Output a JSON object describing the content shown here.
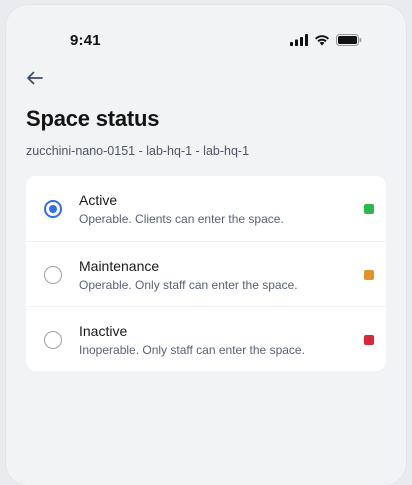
{
  "status_bar": {
    "time": "9:41"
  },
  "page": {
    "title": "Space status",
    "subtitle": "zucchini-nano-0151 - lab-hq-1 - lab-hq-1"
  },
  "options": [
    {
      "label": "Active",
      "description": "Operable. Clients can enter the space.",
      "selected": true,
      "color": "#2fb84a"
    },
    {
      "label": "Maintenance",
      "description": "Operable. Only staff can enter the space.",
      "selected": false,
      "color": "#e3922c"
    },
    {
      "label": "Inactive",
      "description": "Inoperable. Only staff can enter the space.",
      "selected": false,
      "color": "#d8263a"
    }
  ],
  "colors": {
    "accent": "#2f6fec",
    "background": "#f2f3f5",
    "card": "#ffffff"
  },
  "icons": [
    "signal-icon",
    "wifi-icon",
    "battery-icon",
    "back-arrow-icon"
  ]
}
